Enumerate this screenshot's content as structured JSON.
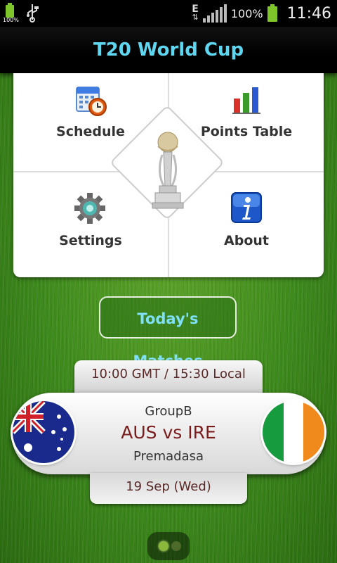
{
  "status_bar": {
    "battery_small_label": "100%",
    "battery_percent": "100%",
    "network_label": "E",
    "time": "11:46"
  },
  "app": {
    "title": "T20 World Cup"
  },
  "menu": {
    "schedule_label": "Schedule",
    "points_table_label": "Points Table",
    "settings_label": "Settings",
    "about_label": "About"
  },
  "todays_matches_label": "Today's Matches",
  "match": {
    "time": "10:00 GMT / 15:30 Local",
    "group": "GroupB",
    "teams": "AUS vs IRE",
    "venue": "Premadasa",
    "date": "19 Sep (Wed)",
    "team1_flag": "australia-flag-icon",
    "team2_flag": "ireland-flag-icon"
  },
  "pager": {
    "current_page": 1,
    "total_pages": 2
  },
  "colors": {
    "title_text": "#5fd6f0",
    "todays_text": "#7fe0f8",
    "teams_text": "#7a1c1c"
  }
}
